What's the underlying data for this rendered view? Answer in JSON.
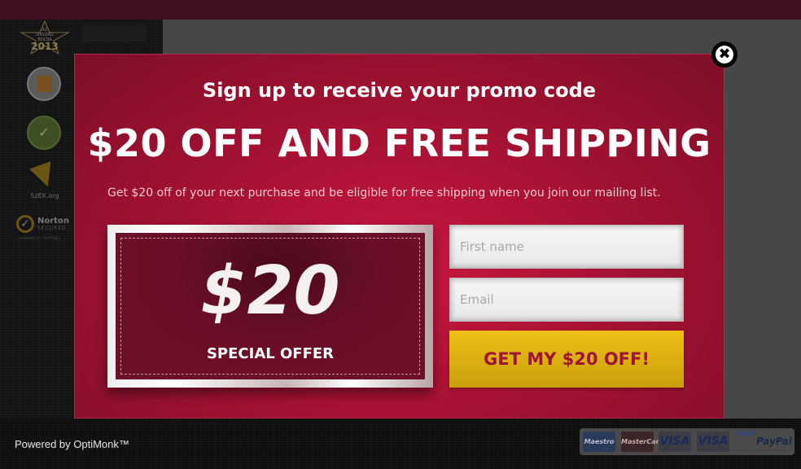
{
  "background": {
    "sidebar_badges": [
      {
        "name": "az-orszag-boltja-2013",
        "lines": [
          "AZ",
          "ORSZÁG",
          "BOLTJA"
        ],
        "year": "2013"
      },
      {
        "name": "vasarlo-badge"
      },
      {
        "name": "megbizhato-bolt",
        "glyph": "✓"
      },
      {
        "name": "szek-org",
        "label": "SzEK.org"
      },
      {
        "name": "norton-secured",
        "title": "Norton",
        "subtitle": "SECURED",
        "powered": "powered by VeriSign",
        "glyph": "✓"
      }
    ]
  },
  "popup": {
    "close_glyph": "✖",
    "subtitle": "Sign up to receive your promo code",
    "headline": "$20 OFF AND FREE SHIPPING",
    "description": "Get $20 off of your next purchase and be eligible for free shipping when you join our mailing list.",
    "coupon": {
      "amount": "$20",
      "label": "SPECIAL OFFER"
    },
    "form": {
      "first_name_placeholder": "First name",
      "first_name_value": "",
      "email_placeholder": "Email",
      "email_value": "",
      "submit_label": "GET MY $20 OFF!"
    }
  },
  "footer": {
    "powered_by": "Powered by OptiMonk™",
    "payment_methods": [
      "Maestro",
      "MasterCard",
      "VISA",
      "VISA",
      "PayU",
      "PayPal"
    ]
  },
  "colors": {
    "popup_red": "#a81234",
    "coupon_maroon": "#6a0f27",
    "button_yellow": "#e3b412",
    "button_text": "#9c1535"
  }
}
